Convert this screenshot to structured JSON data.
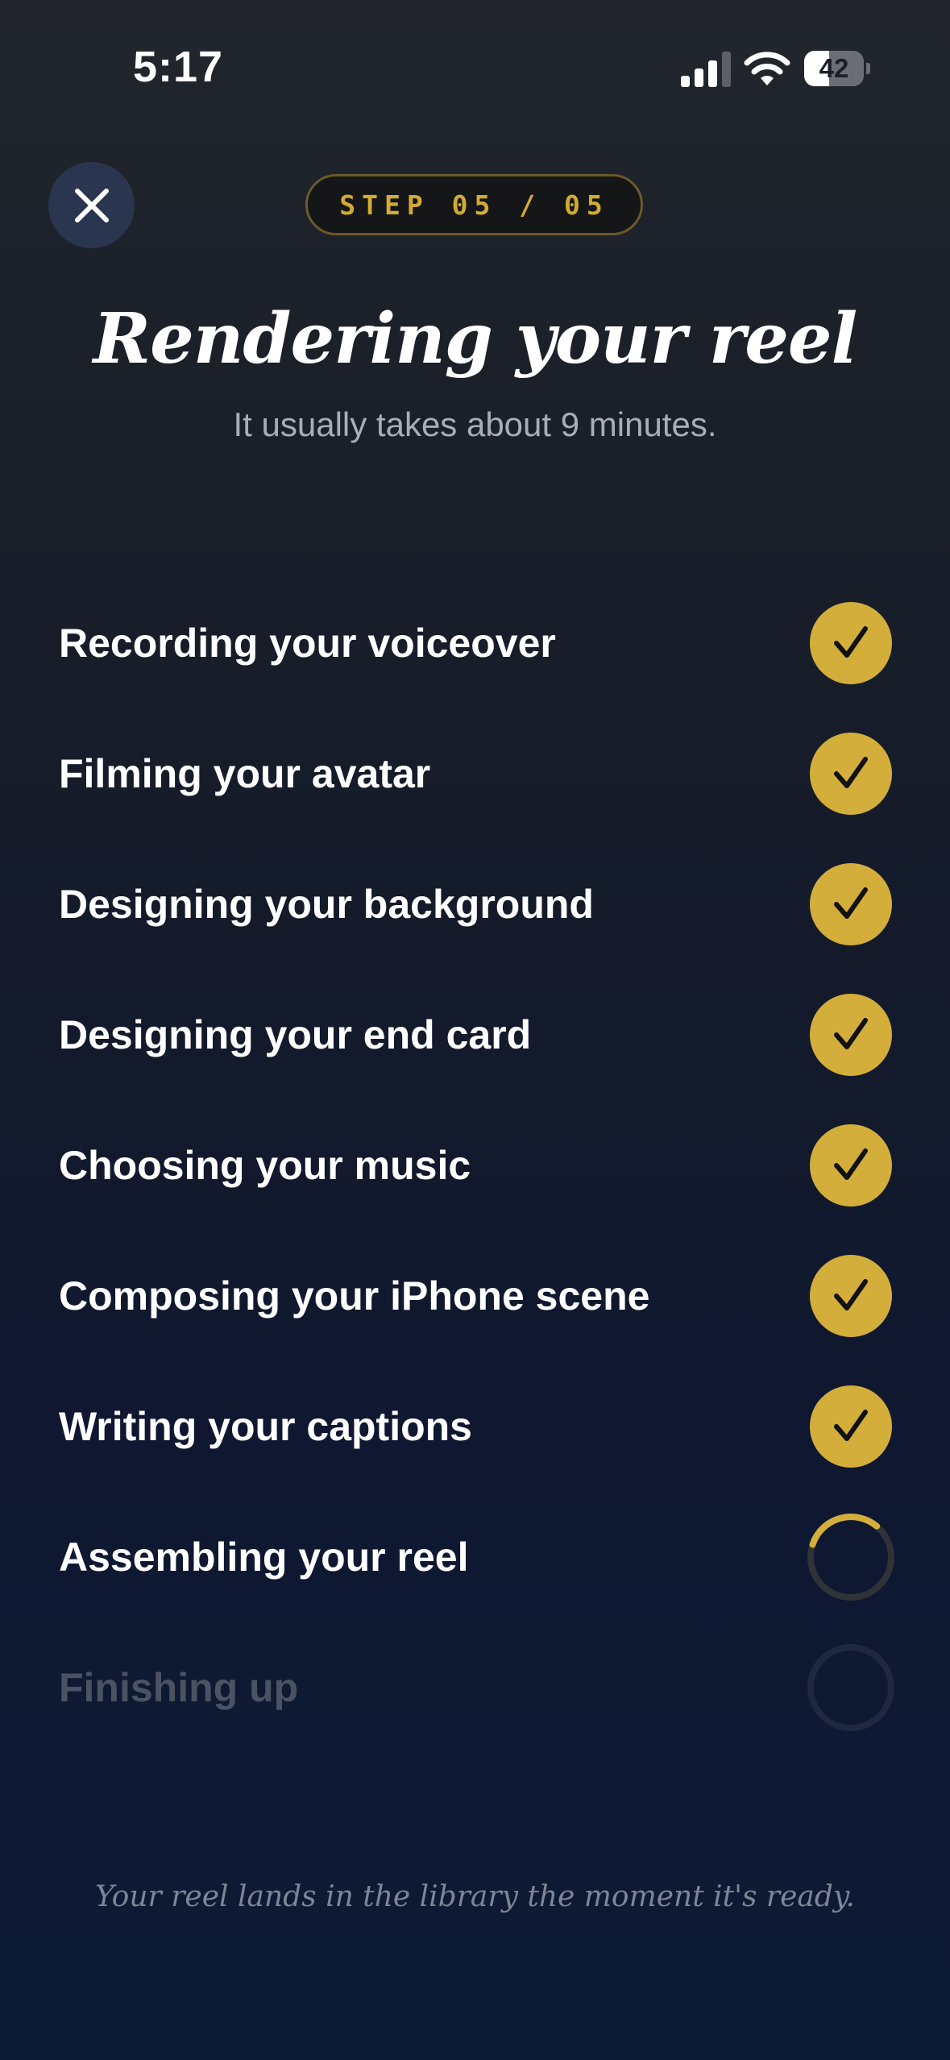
{
  "status_bar": {
    "time": "5:17",
    "battery_level": "42",
    "battery_fraction": 0.42
  },
  "header": {
    "close_icon": "close-icon",
    "step_label": "STEP 05 / 05"
  },
  "title": "Rendering your reel",
  "subtitle": "It usually takes about 9 minutes.",
  "tasks": [
    {
      "label": "Recording your voiceover",
      "status": "done"
    },
    {
      "label": "Filming your avatar",
      "status": "done"
    },
    {
      "label": "Designing your background",
      "status": "done"
    },
    {
      "label": "Designing your end card",
      "status": "done"
    },
    {
      "label": "Choosing your music",
      "status": "done"
    },
    {
      "label": "Composing your iPhone scene",
      "status": "done"
    },
    {
      "label": "Writing your captions",
      "status": "done"
    },
    {
      "label": "Assembling your reel",
      "status": "in-progress"
    },
    {
      "label": "Finishing up",
      "status": "pending"
    }
  ],
  "footer_note": "Your reel lands in the library the moment it's ready.",
  "colors": {
    "accent_gold": "#d3ae3a",
    "background_top": "#22262c",
    "background_bottom": "#0d1a36",
    "muted_text": "#a9adb6",
    "pending_text": "#4a5263"
  }
}
